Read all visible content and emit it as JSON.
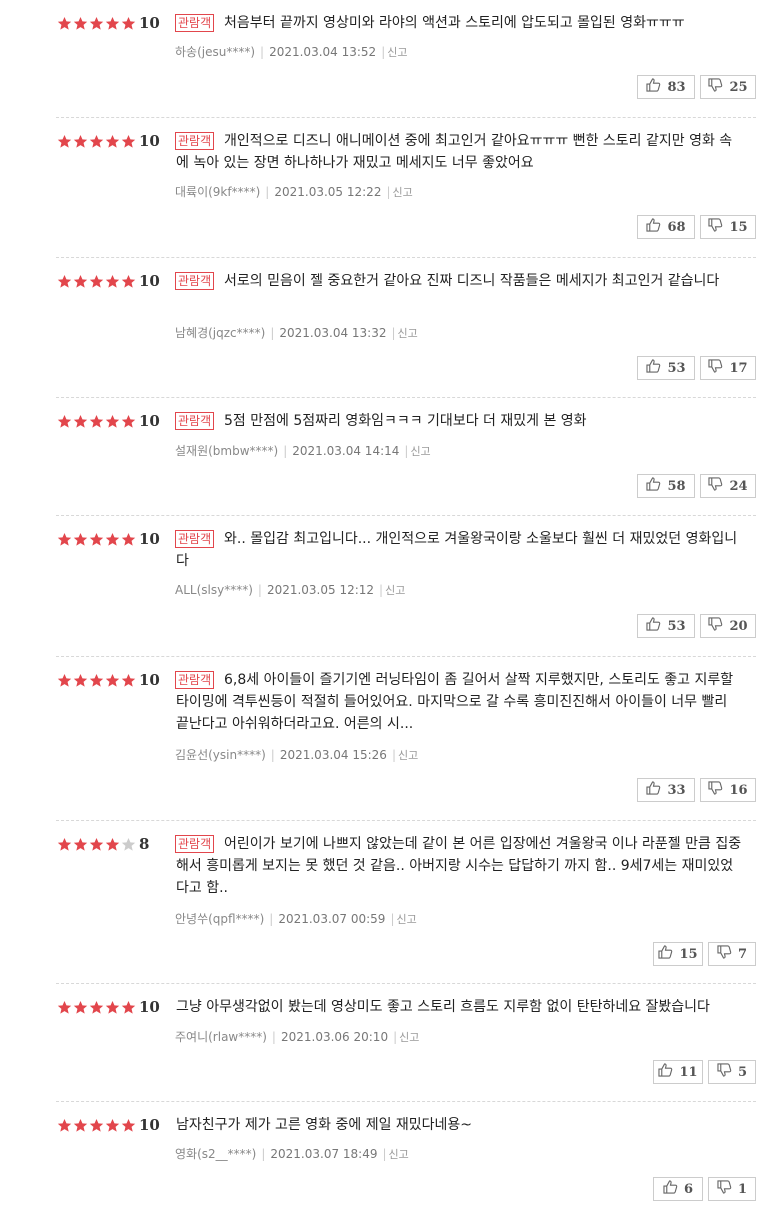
{
  "badge_label": "관람객",
  "report_label": "신고",
  "colors": {
    "star_on": "#e2464c",
    "star_off": "#cccccc",
    "badge": "#e2464c"
  },
  "reviews": [
    {
      "stars": 5,
      "score": "10",
      "badge": true,
      "text": "처음부터 끝까지 영상미와 라야의 액션과 스토리에 압도되고 몰입된 영화ㅠㅠㅠ",
      "author": "하송(jesu****)",
      "date": "2021.03.04 13:52",
      "likes": "83",
      "dislikes": "25"
    },
    {
      "stars": 5,
      "score": "10",
      "badge": true,
      "text": "개인적으로 디즈니 애니메이션 중에 최고인거 같아요ㅠㅠㅠ 뻔한 스토리 같지만 영화 속에 녹아 있는 장면 하나하나가 재밌고 메세지도 너무 좋았어요",
      "author": "대륙이(9kf****)",
      "date": "2021.03.05 12:22",
      "likes": "68",
      "dislikes": "15"
    },
    {
      "stars": 5,
      "score": "10",
      "badge": true,
      "text": "서로의 믿음이 젤 중요한거 같아요 진짜 디즈니 작품들은 메세지가 최고인거 같습니다",
      "author": "남혜경(jqzc****)",
      "date": "2021.03.04 13:32",
      "likes": "53",
      "dislikes": "17"
    },
    {
      "stars": 5,
      "score": "10",
      "badge": true,
      "text": "5점 만점에 5점짜리 영화임ㅋㅋㅋ 기대보다 더 재밌게 본 영화",
      "author": "설재원(bmbw****)",
      "date": "2021.03.04 14:14",
      "likes": "58",
      "dislikes": "24"
    },
    {
      "stars": 5,
      "score": "10",
      "badge": true,
      "text": "와.. 몰입감 최고입니다... 개인적으로 겨울왕국이랑 소울보다 훨씬 더 재밌었던 영화입니다",
      "author": "ALL(slsy****)",
      "date": "2021.03.05 12:12",
      "likes": "53",
      "dislikes": "20"
    },
    {
      "stars": 5,
      "score": "10",
      "badge": true,
      "text": "6,8세 아이들이 즐기기엔 러닝타임이 좀 길어서 살짝 지루했지만, 스토리도 좋고 지루할 타이밍에 격투씬등이 적절히 들어있어요. 마지막으로 갈 수록 흥미진진해서 아이들이 너무 빨리 끝난다고 아쉬워하더라고요. 어른의 시...",
      "author": "김윤선(ysin****)",
      "date": "2021.03.04 15:26",
      "likes": "33",
      "dislikes": "16"
    },
    {
      "stars": 4,
      "score": "8",
      "badge": true,
      "text": "어린이가 보기에 나쁘지 않았는데 같이 본 어른 입장에선 겨울왕국 이나 라푼젤 만큼 집중해서 흥미롭게 보지는 못 했던 것 같음.. 아버지랑 시수는 답답하기 까지 함.. 9세7세는 재미있었다고 함..",
      "author": "안녕쑤(qpfl****)",
      "date": "2021.03.07 00:59",
      "likes": "15",
      "dislikes": "7"
    },
    {
      "stars": 5,
      "score": "10",
      "badge": false,
      "text": "그냥 아무생각없이 봤는데 영상미도 좋고 스토리 흐름도 지루함 없이 탄탄하네요 잘봤습니다",
      "author": "주여니(rlaw****)",
      "date": "2021.03.06 20:10",
      "likes": "11",
      "dislikes": "5"
    },
    {
      "stars": 5,
      "score": "10",
      "badge": false,
      "text": "남자친구가 제가 고른 영화 중에 제일 재밌다네용~",
      "author": "영화(s2__****)",
      "date": "2021.03.07 18:49",
      "likes": "6",
      "dislikes": "1"
    }
  ]
}
